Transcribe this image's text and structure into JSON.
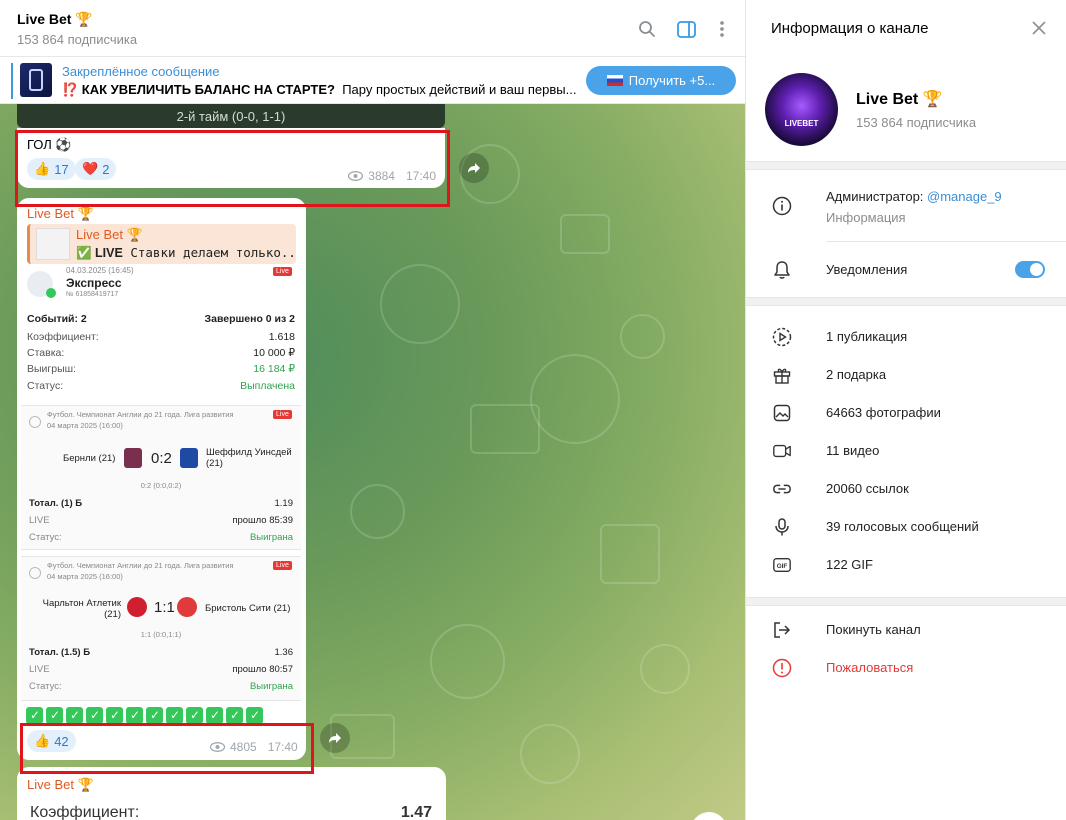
{
  "header": {
    "title": "Live Bet 🏆",
    "subscribers": "153 864 подписчика"
  },
  "pinned": {
    "label": "Закреплённое сообщение",
    "text_bold": "⁉️ КАК УВЕЛИЧИТЬ БАЛАНС НА СТАРТЕ?",
    "text_rest": "Пару простых действий и ваш первы...",
    "button_label": "Получить +5..."
  },
  "messages": [
    {
      "strip": "2-й тайм (0-0, 1-1)",
      "text": "ГОЛ ⚽",
      "reactions": [
        {
          "emoji": "👍",
          "count": "17"
        },
        {
          "emoji": "❤️",
          "count": "2"
        }
      ],
      "views": "3884",
      "time": "17:40"
    },
    {
      "author": "Live Bet 🏆",
      "reply_name": "Live Bet 🏆",
      "reply_text_bold": "✅ LIVE",
      "reply_text": "Ставки делаем только...",
      "ticket": {
        "date": "04.03.2025 (16:45)",
        "type": "Экспресс",
        "number": "№ 61858419717",
        "events_label": "Событий: 2",
        "completed": "Завершено 0 из 2",
        "rows": [
          {
            "label": "Коэффициент:",
            "value": "1.618"
          },
          {
            "label": "Ставка:",
            "value": "10 000 ₽"
          },
          {
            "label": "Выигрыш:",
            "value": "16 184 ₽"
          },
          {
            "label": "Статус:",
            "value": "Выплачена"
          }
        ],
        "matches": [
          {
            "league": "Футбол. Чемпионат Англии до 21 года. Лига развития",
            "date": "04 марта 2025 (16:00)",
            "home": "Бернли (21)",
            "away": "Шеффилд Уинсдей (21)",
            "score": "0:2",
            "detail": "0:2 (0:0,0:2)",
            "bet": "Тотал. (1) Б",
            "odds": "1.19",
            "mode": "LIVE",
            "time": "прошло 85:39",
            "status_label": "Статус:",
            "status": "Выиграна"
          },
          {
            "league": "Футбол. Чемпионат Англии до 21 года. Лига развития",
            "date": "04 марта 2025 (16:00)",
            "home": "Чарльтон Атлетик (21)",
            "away": "Бристоль Сити (21)",
            "score": "1:1",
            "detail": "1:1 (0:0,1:1)",
            "bet": "Тотал. (1.5) Б",
            "odds": "1.36",
            "mode": "LIVE",
            "time": "прошло 80:57",
            "status_label": "Статус:",
            "status": "Выиграна"
          }
        ],
        "live_badge": "Live"
      },
      "checks_count": 12,
      "reactions": [
        {
          "emoji": "👍",
          "count": "42"
        }
      ],
      "views": "4805",
      "time": "17:40"
    },
    {
      "author": "Live Bet 🏆",
      "label": "Коэффициент:",
      "value": "1.47"
    }
  ],
  "panel": {
    "title": "Информация о канале",
    "channel_name": "Live Bet 🏆",
    "channel_sub": "153 864 подписчика",
    "avatar_text": "LIVEBET",
    "admin_label": "Администратор:",
    "admin_link": "@manage_9",
    "info_label": "Информация",
    "notifications": "Уведомления",
    "notifications_on": true,
    "stats": [
      {
        "icon": "publication-icon",
        "text": "1 публикация"
      },
      {
        "icon": "gift-icon",
        "text": "2 подарка"
      },
      {
        "icon": "photo-icon",
        "text": "64663 фотографии"
      },
      {
        "icon": "video-icon",
        "text": "11 видео"
      },
      {
        "icon": "link-icon",
        "text": "20060 ссылок"
      },
      {
        "icon": "microphone-icon",
        "text": "39 голосовых сообщений"
      },
      {
        "icon": "gif-icon",
        "text": "122 GIF"
      }
    ],
    "leave": "Покинуть канал",
    "report": "Пожаловаться"
  },
  "colors": {
    "accent": "#4aa3e8",
    "author": "#e05a1f",
    "highlight": "#e0151c",
    "danger": "#e53935",
    "success": "#2fa44f"
  }
}
